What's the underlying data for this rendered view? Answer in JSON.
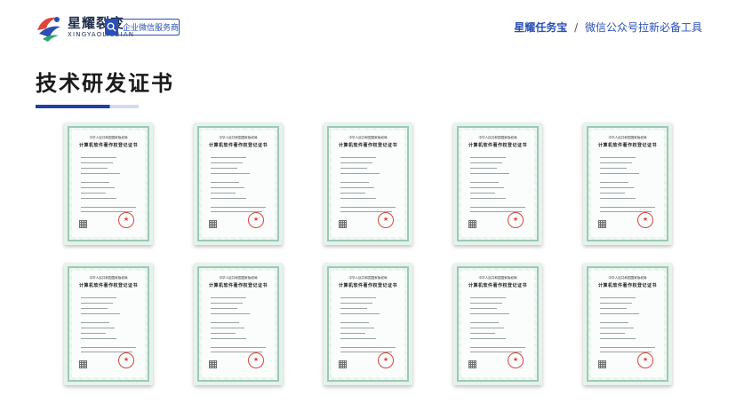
{
  "header": {
    "brand_name": "星耀裂变",
    "brand_sub": "XINGYAOLIEBIAN",
    "service_label": "企业微信服务商",
    "tagline_strong": "星耀任务宝",
    "tagline_sep": "/",
    "tagline_rest": "微信公众号拉新必备工具",
    "brand_colors": {
      "primary": "#2a4fb5",
      "dark": "#1f2d4d",
      "accent_red": "#e0443a",
      "accent_green": "#2fa66b"
    }
  },
  "page_title": "技术研发证书",
  "certificates": {
    "items": [
      {
        "head": "中华人民共和国国家版权局",
        "title": "计算机软件著作权登记证书"
      },
      {
        "head": "中华人民共和国国家版权局",
        "title": "计算机软件著作权登记证书"
      },
      {
        "head": "中华人民共和国国家版权局",
        "title": "计算机软件著作权登记证书"
      },
      {
        "head": "中华人民共和国国家版权局",
        "title": "计算机软件著作权登记证书"
      },
      {
        "head": "中华人民共和国国家版权局",
        "title": "计算机软件著作权登记证书"
      },
      {
        "head": "中华人民共和国国家版权局",
        "title": "计算机软件著作权登记证书"
      },
      {
        "head": "中华人民共和国国家版权局",
        "title": "计算机软件著作权登记证书"
      },
      {
        "head": "中华人民共和国国家版权局",
        "title": "计算机软件著作权登记证书"
      },
      {
        "head": "中华人民共和国国家版权局",
        "title": "计算机软件著作权登记证书"
      },
      {
        "head": "中华人民共和国国家版权局",
        "title": "计算机软件著作权登记证书"
      }
    ]
  }
}
